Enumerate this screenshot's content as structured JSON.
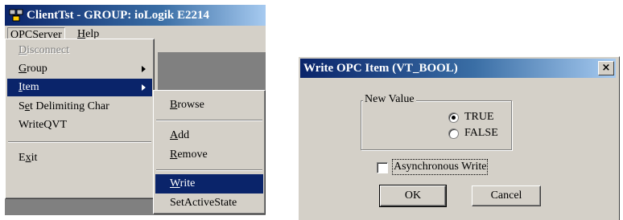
{
  "client_window": {
    "title": "ClientTst - GROUP: ioLogik E2214",
    "menubar": [
      "OPCServer",
      "Help"
    ]
  },
  "opc_menu": {
    "items": [
      {
        "label": "Disconnect",
        "disabled": true
      },
      {
        "label": "Group",
        "submenu": true
      },
      {
        "label": "Item",
        "submenu": true,
        "selected": true
      },
      {
        "label": "Set Delimiting Char"
      },
      {
        "label": "WriteQVT"
      },
      {
        "label": "Exit"
      }
    ]
  },
  "item_submenu": {
    "items": [
      {
        "label": "Browse"
      },
      {
        "label": "Add"
      },
      {
        "label": "Remove"
      },
      {
        "label": "Write",
        "selected": true
      },
      {
        "label": "SetActiveState"
      }
    ]
  },
  "write_dialog": {
    "title": "Write OPC Item (VT_BOOL)",
    "close_glyph": "×",
    "group_label": "New Value",
    "options": [
      {
        "label": "TRUE",
        "checked": true
      },
      {
        "label": "FALSE",
        "checked": false
      }
    ],
    "async_label": "Asynchronous Write",
    "async_checked": false,
    "ok_label": "OK",
    "cancel_label": "Cancel"
  }
}
